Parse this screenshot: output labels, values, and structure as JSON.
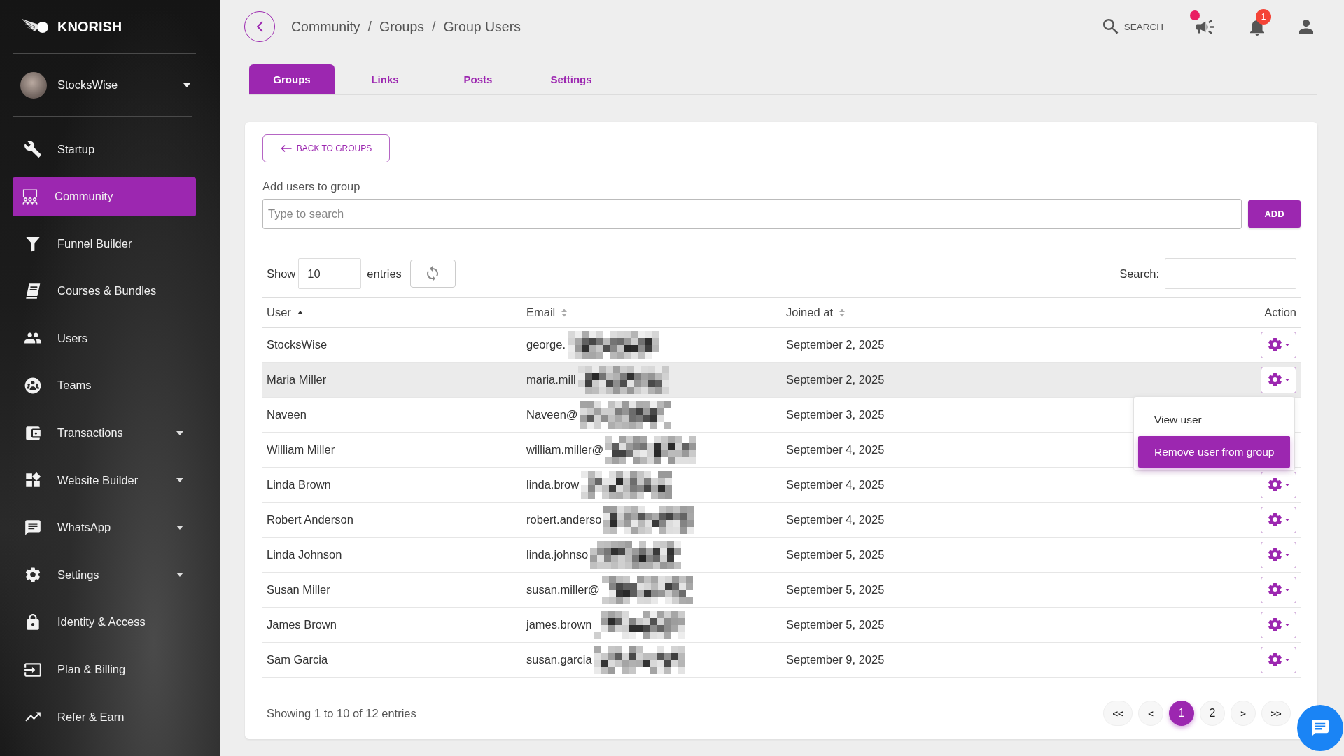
{
  "sidebar": {
    "brand": "KNORISH",
    "profile": {
      "name": "StocksWise",
      "expandable": true
    },
    "items": [
      {
        "label": "Startup",
        "selected": false,
        "expandable": false
      },
      {
        "label": "Community",
        "selected": true,
        "expandable": false
      },
      {
        "label": "Funnel Builder",
        "selected": false,
        "expandable": false
      },
      {
        "label": "Courses & Bundles",
        "selected": false,
        "expandable": false
      },
      {
        "label": "Users",
        "selected": false,
        "expandable": false
      },
      {
        "label": "Teams",
        "selected": false,
        "expandable": false
      },
      {
        "label": "Transactions",
        "selected": false,
        "expandable": true
      },
      {
        "label": "Website Builder",
        "selected": false,
        "expandable": true
      },
      {
        "label": "WhatsApp",
        "selected": false,
        "expandable": true
      },
      {
        "label": "Settings",
        "selected": false,
        "expandable": true
      },
      {
        "label": "Identity & Access",
        "selected": false,
        "expandable": false
      },
      {
        "label": "Plan & Billing",
        "selected": false,
        "expandable": false
      },
      {
        "label": "Refer & Earn",
        "selected": false,
        "expandable": false
      }
    ]
  },
  "header": {
    "breadcrumb": [
      {
        "kind": "item",
        "text": "Community"
      },
      {
        "kind": "separator",
        "text": "/"
      },
      {
        "kind": "item",
        "text": "Groups"
      },
      {
        "kind": "separator",
        "text": "/"
      },
      {
        "kind": "item",
        "text": "Group Users"
      }
    ],
    "search_label": "SEARCH",
    "announcements": {
      "unread": true
    },
    "notifications": {
      "badge": "1"
    }
  },
  "tabs": [
    {
      "label": "Groups",
      "selected": true
    },
    {
      "label": "Links",
      "selected": false
    },
    {
      "label": "Posts",
      "selected": false
    },
    {
      "label": "Settings",
      "selected": false
    }
  ],
  "panel": {
    "back_button": "BACK TO GROUPS",
    "add_users": {
      "label": "Add users to group",
      "placeholder": "Type to search",
      "button": "ADD"
    },
    "length_menu": {
      "before": "Show",
      "value": "10",
      "after": "entries"
    },
    "search": {
      "label": "Search:"
    },
    "table": {
      "columns": [
        {
          "label": "User",
          "sortable": true,
          "sorted": true
        },
        {
          "label": "Email",
          "sortable": true,
          "sorted": false
        },
        {
          "label": "Joined at",
          "sortable": true,
          "sorted": false
        },
        {
          "label": "Action",
          "sortable": false,
          "sorted": false
        }
      ],
      "rows": [
        {
          "user": "StocksWise",
          "email": "george.",
          "redacted": true,
          "joined": "September 2, 2025",
          "highlighted": false,
          "menu_open": false
        },
        {
          "user": "Maria Miller",
          "email": "maria.mill",
          "redacted": true,
          "joined": "September 2, 2025",
          "highlighted": true,
          "menu_open": true
        },
        {
          "user": "Naveen",
          "email": "Naveen@",
          "redacted": true,
          "joined": "September 3, 2025",
          "highlighted": false,
          "menu_open": false
        },
        {
          "user": "William Miller",
          "email": "william.miller@",
          "redacted": true,
          "joined": "September 4, 2025",
          "highlighted": false,
          "menu_open": false
        },
        {
          "user": "Linda Brown",
          "email": "linda.brow",
          "redacted": true,
          "joined": "September 4, 2025",
          "highlighted": false,
          "menu_open": false
        },
        {
          "user": "Robert Anderson",
          "email": "robert.anderso",
          "redacted": true,
          "joined": "September 4, 2025",
          "highlighted": false,
          "menu_open": false
        },
        {
          "user": "Linda Johnson",
          "email": "linda.johnso",
          "redacted": true,
          "joined": "September 5, 2025",
          "highlighted": false,
          "menu_open": false
        },
        {
          "user": "Susan Miller",
          "email": "susan.miller@",
          "redacted": true,
          "joined": "September 5, 2025",
          "highlighted": false,
          "menu_open": false
        },
        {
          "user": "James Brown",
          "email": "james.brown",
          "redacted": true,
          "joined": "September 5, 2025",
          "highlighted": false,
          "menu_open": false
        },
        {
          "user": "Sam Garcia",
          "email": "susan.garcia",
          "redacted": true,
          "joined": "September 9, 2025",
          "highlighted": false,
          "menu_open": false
        }
      ]
    },
    "row_menu": {
      "items": [
        {
          "label": "View user",
          "selected": false
        },
        {
          "label": "Remove user from group",
          "selected": true
        }
      ]
    },
    "info": "Showing 1 to 10 of 12 entries",
    "pagination": [
      {
        "kind": "jump",
        "label": "<<",
        "selected": false
      },
      {
        "kind": "step",
        "label": "<",
        "selected": false
      },
      {
        "kind": "page",
        "label": "1",
        "selected": true
      },
      {
        "kind": "page",
        "label": "2",
        "selected": false
      },
      {
        "kind": "step",
        "label": ">",
        "selected": false
      },
      {
        "kind": "jump",
        "label": ">>",
        "selected": false
      }
    ]
  }
}
